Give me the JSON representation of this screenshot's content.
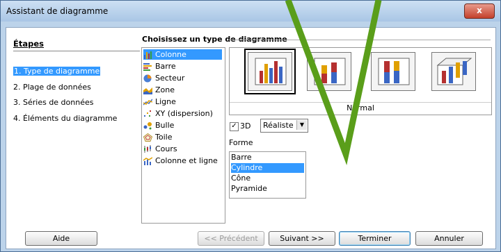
{
  "window": {
    "title": "Assistant de diagramme",
    "close_label": "x"
  },
  "steps": {
    "title": "Étapes",
    "items": [
      {
        "label": "1. Type de diagramme",
        "active": true
      },
      {
        "label": "2. Plage de données",
        "active": false
      },
      {
        "label": "3. Séries de données",
        "active": false
      },
      {
        "label": "4. Éléments du diagramme",
        "active": false
      }
    ]
  },
  "chart_type": {
    "section_title": "Choisissez un type de diagramme",
    "types": [
      {
        "label": "Colonne",
        "icon": "column-chart-icon",
        "selected": true
      },
      {
        "label": "Barre",
        "icon": "bar-chart-icon"
      },
      {
        "label": "Secteur",
        "icon": "pie-chart-icon"
      },
      {
        "label": "Zone",
        "icon": "area-chart-icon"
      },
      {
        "label": "Ligne",
        "icon": "line-chart-icon"
      },
      {
        "label": "XY (dispersion)",
        "icon": "scatter-chart-icon"
      },
      {
        "label": "Bulle",
        "icon": "bubble-chart-icon"
      },
      {
        "label": "Toile",
        "icon": "net-chart-icon"
      },
      {
        "label": "Cours",
        "icon": "stock-chart-icon"
      },
      {
        "label": "Colonne et ligne",
        "icon": "column-line-chart-icon"
      }
    ],
    "variant_label": "Normal",
    "three_d": {
      "checked": true,
      "label": "3D"
    },
    "look": {
      "value": "Réaliste"
    },
    "shape": {
      "title": "Forme",
      "options": [
        {
          "label": "Barre",
          "selected": false
        },
        {
          "label": "Cylindre",
          "selected": true
        },
        {
          "label": "Cône",
          "selected": false
        },
        {
          "label": "Pyramide",
          "selected": false
        }
      ]
    }
  },
  "buttons": {
    "help": "Aide",
    "previous": "<< Précédent",
    "next": "Suivant >>",
    "finish": "Terminer",
    "cancel": "Annuler"
  },
  "colors": {
    "selection": "#3399ff",
    "annotation": "#5a9e1a"
  }
}
